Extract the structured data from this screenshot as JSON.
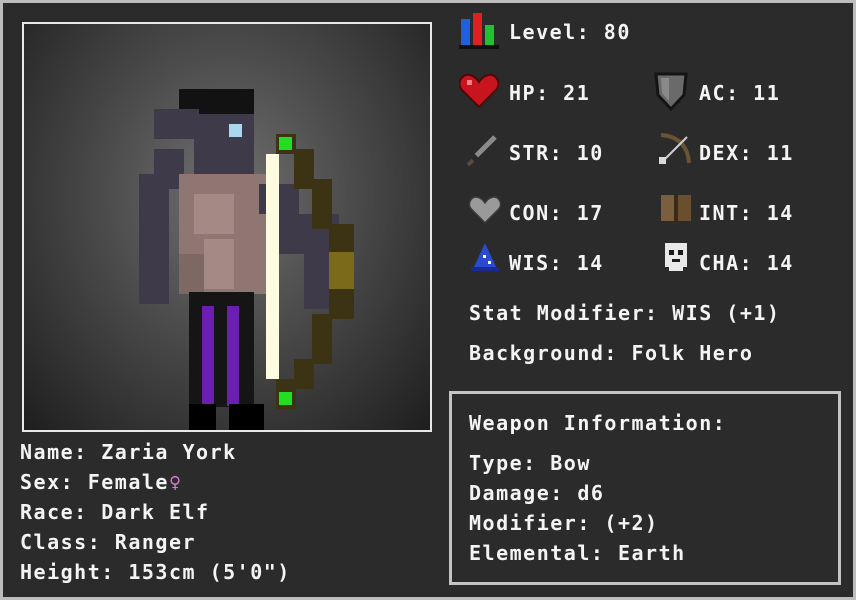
{
  "character": {
    "name_label": "Name:",
    "name": "Zaria York",
    "sex_label": "Sex:",
    "sex": "Female",
    "sex_symbol": "♀",
    "race_label": "Race:",
    "race": "Dark Elf",
    "class_label": "Class:",
    "class": "Ranger",
    "height_label": "Height:",
    "height": "153cm (5'0\")"
  },
  "stats": {
    "level_label": "Level:",
    "level": "80",
    "hp_label": "HP:",
    "hp": "21",
    "ac_label": "AC:",
    "ac": "11",
    "str_label": "STR:",
    "str": "10",
    "dex_label": "DEX:",
    "dex": "11",
    "con_label": "CON:",
    "con": "17",
    "int_label": "INT:",
    "int": "14",
    "wis_label": "WIS:",
    "wis": "14",
    "cha_label": "CHA:",
    "cha": "14"
  },
  "modifier": {
    "label": "Stat Modifier:",
    "value": "WIS (+1)"
  },
  "background": {
    "label": "Background:",
    "value": "Folk Hero"
  },
  "weapon": {
    "title": "Weapon Information:",
    "type_label": "Type:",
    "type": "Bow",
    "damage_label": "Damage:",
    "damage": "d6",
    "modifier_label": "Modifier:",
    "modifier": "(+2)",
    "elemental_label": "Elemental:",
    "elemental": "Earth"
  },
  "colors": {
    "frame_border": "#bdbdbd",
    "background": "#2b2b2b",
    "text": "#f4f4f4",
    "female_symbol": "#d77ad6",
    "bow_gem": "#22dd22"
  },
  "icons": {
    "level": "level-bars-icon",
    "hp": "heart-icon",
    "ac": "shield-icon",
    "str": "sword-icon",
    "dex": "bow-arrow-icon",
    "con": "gray-heart-icon",
    "int": "book-icon",
    "wis": "wizard-hat-icon",
    "cha": "mask-icon"
  }
}
